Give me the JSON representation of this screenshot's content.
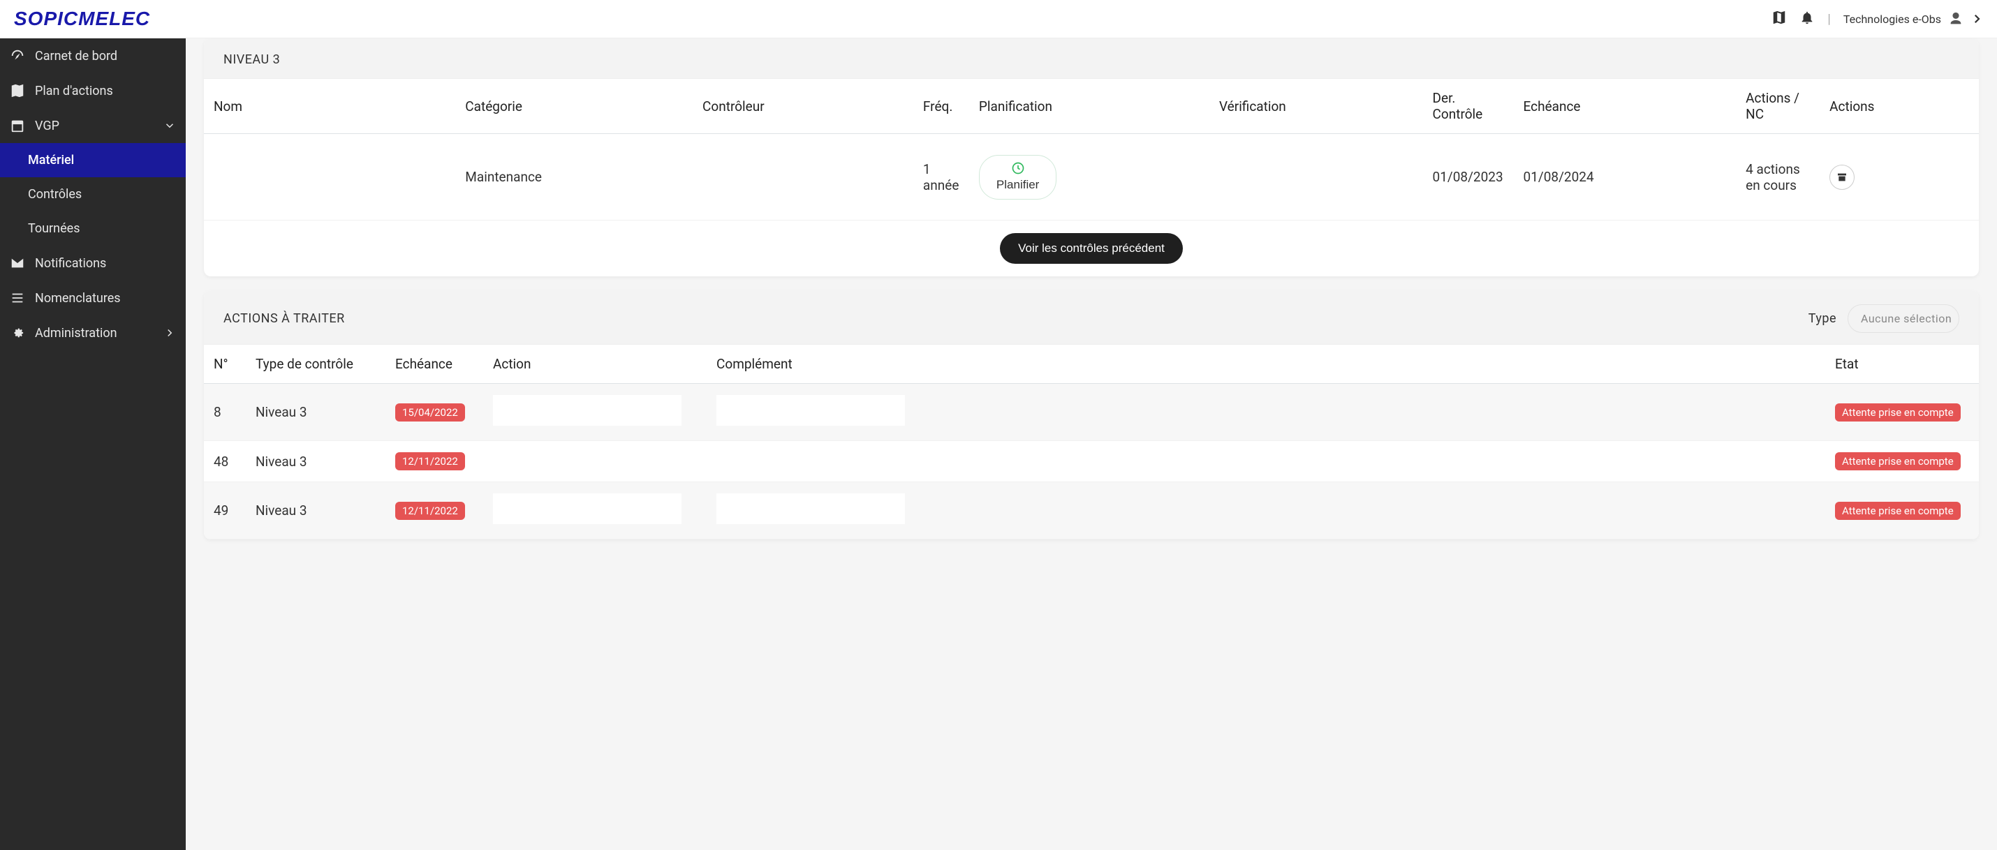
{
  "header": {
    "logo": "SOPICMELEC",
    "user": "Technologies e-Obs"
  },
  "sidebar": {
    "items": [
      {
        "label": "Carnet de bord",
        "icon": "dashboard-icon"
      },
      {
        "label": "Plan d'actions",
        "icon": "map-icon"
      },
      {
        "label": "VGP",
        "icon": "calendar-icon",
        "expandable": true
      },
      {
        "label": "Matériel",
        "indent": true,
        "active": true
      },
      {
        "label": "Contrôles",
        "indent": true
      },
      {
        "label": "Tournées",
        "indent": true
      },
      {
        "label": "Notifications",
        "icon": "mail-icon"
      },
      {
        "label": "Nomenclatures",
        "icon": "list-icon"
      },
      {
        "label": "Administration",
        "icon": "gear-icon",
        "expandable": true
      }
    ]
  },
  "panel_niveau": {
    "title": "NIVEAU 3",
    "columns": [
      "Nom",
      "Catégorie",
      "Contrôleur",
      "Fréq.",
      "Planification",
      "Vérification",
      "Der. Contrôle",
      "Echéance",
      "Actions / NC",
      "Actions"
    ],
    "row": {
      "categorie": "Maintenance",
      "freq": "1 année",
      "planifier_label": "Planifier",
      "der_controle": "01/08/2023",
      "echeance": "01/08/2024",
      "actions_nc": "4 actions en cours"
    },
    "footer_btn": "Voir les contrôles précédent"
  },
  "panel_actions": {
    "title": "ACTIONS À TRAITER",
    "filter_label": "Type",
    "filter_placeholder": "Aucune sélection",
    "columns": [
      "N°",
      "Type de contrôle",
      "Echéance",
      "Action",
      "Complément",
      "Etat"
    ],
    "rows": [
      {
        "n": "8",
        "type": "Niveau 3",
        "echeance": "15/04/2022",
        "etat": "Attente prise en compte",
        "alt": true
      },
      {
        "n": "48",
        "type": "Niveau 3",
        "echeance": "12/11/2022",
        "etat": "Attente prise en compte",
        "alt": false
      },
      {
        "n": "49",
        "type": "Niveau 3",
        "echeance": "12/11/2022",
        "etat": "Attente prise en compte",
        "alt": true
      }
    ]
  }
}
